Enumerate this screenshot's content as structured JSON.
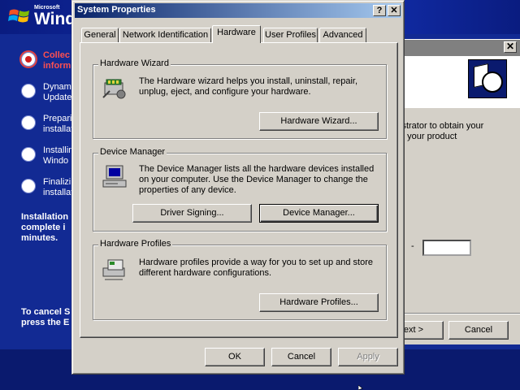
{
  "setup": {
    "logo_small": "Microsoft",
    "logo_large": "Wind",
    "steps": [
      {
        "label": "Collec\ninform",
        "active": true
      },
      {
        "label": "Dynami\nUpdate",
        "active": false
      },
      {
        "label": "Prepari\ninstallat",
        "active": false
      },
      {
        "label": "Installin\nWindo",
        "active": false
      },
      {
        "label": "Finalizi\ninstallat",
        "active": false
      }
    ],
    "estimate_text": "Installation\ncomplete i\nminutes.",
    "cancel_text": "To cancel S\npress the E"
  },
  "bg_wizard": {
    "close_label": "✕",
    "body_text": "istrator to obtain your\ne your product",
    "field_prefix": "-",
    "next_label": "ext >",
    "cancel_label": "Cancel"
  },
  "dialog": {
    "title": "System Properties",
    "help_label": "?",
    "close_label": "✕",
    "tabs": [
      "General",
      "Network Identification",
      "Hardware",
      "User Profiles",
      "Advanced"
    ],
    "groups": {
      "wizard": {
        "title": "Hardware Wizard",
        "description": "The Hardware wizard helps you install, uninstall, repair,\nunplug, eject, and configure your hardware.",
        "button": "Hardware Wizard..."
      },
      "device_manager": {
        "title": "Device Manager",
        "description": "The Device Manager lists all the hardware devices installed\non your computer. Use the Device Manager to change the\nproperties of any device.",
        "signing_button": "Driver Signing...",
        "button": "Device Manager..."
      },
      "profiles": {
        "title": "Hardware Profiles",
        "description": "Hardware profiles provide a way for you to set up and store\ndifferent hardware configurations.",
        "button": "Hardware Profiles..."
      }
    },
    "ok_label": "OK",
    "cancel_label": "Cancel",
    "apply_label": "Apply"
  },
  "colors": {
    "titlebar_start": "#0a246a",
    "titlebar_end": "#a6caf0",
    "dialog_face": "#d4d0c8",
    "setup_blue": "#122a93"
  }
}
